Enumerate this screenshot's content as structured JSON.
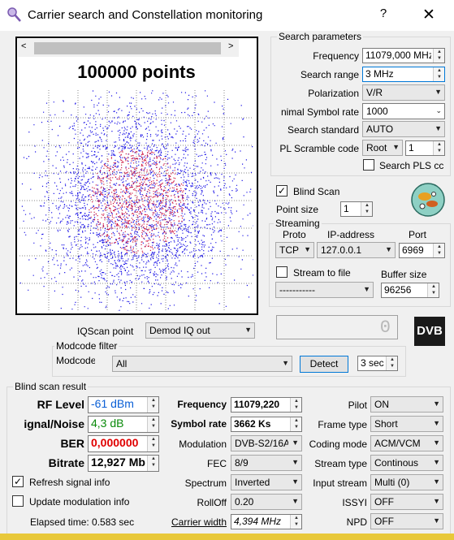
{
  "window": {
    "title": "Carrier search and Constellation monitoring",
    "help": "?",
    "close": "✕"
  },
  "scope": {
    "points_label": "100000 points"
  },
  "search_parameters": {
    "group_title": "Search parameters",
    "frequency_label": "Frequency",
    "frequency_value": "11079,000 MHz",
    "search_range_label": "Search range",
    "search_range_value": "3 MHz",
    "polarization_label": "Polarization",
    "polarization_value": "V/R",
    "min_symbol_rate_label": "nimal Symbol rate",
    "min_symbol_rate_value": "1000",
    "search_standard_label": "Search standard",
    "search_standard_value": "AUTO",
    "pl_scramble_label": "PL Scramble code",
    "pl_scramble_mode": "Root",
    "pl_scramble_value": "1",
    "search_pls_label": "Search PLS cc"
  },
  "blind_scan": {
    "label": "Blind Scan",
    "checked": "✓"
  },
  "point_size": {
    "label": "Point size",
    "value": "1"
  },
  "streaming": {
    "group_title": "Streaming",
    "proto_label": "Proto",
    "proto_value": "TCP",
    "ip_label": "IP-address",
    "ip_value": "127.0.0.1",
    "port_label": "Port",
    "port_value": "6969",
    "stream_to_file_label": "Stream to file",
    "file_value": "-----------",
    "buffer_size_label": "Buffer size",
    "buffer_size_value": "96256"
  },
  "iq": {
    "label": "IQScan point",
    "value": "Demod IQ out",
    "counter": "0"
  },
  "modcode": {
    "group_title": "Modcode filter",
    "label": "Modcode",
    "value": "All",
    "detect": "Detect",
    "time_value": "3 sec"
  },
  "dvb_logo": "DVB",
  "result": {
    "group_title": "Blind scan result",
    "rf_level_label": "RF Level",
    "rf_level_value": "-61 dBm",
    "snr_label": "ignal/Noise",
    "snr_value": "4,3 dB",
    "ber_label": "BER",
    "ber_value": "0,000000",
    "bitrate_label": "Bitrate",
    "bitrate_value": "12,927 Mb",
    "frequency_label": "Frequency",
    "frequency_value": "11079,220",
    "symbol_rate_label": "Symbol rate",
    "symbol_rate_value": "3662 Ks",
    "modulation_label": "Modulation",
    "modulation_value": "DVB-S2/16A",
    "fec_label": "FEC",
    "fec_value": "8/9",
    "spectrum_label": "Spectrum",
    "spectrum_value": "Inverted",
    "rolloff_label": "RollOff",
    "rolloff_value": "0.20",
    "carrier_width_label": "Carrier width",
    "carrier_width_value": "4,394 MHz",
    "pilot_label": "Pilot",
    "pilot_value": "ON",
    "frame_type_label": "Frame type",
    "frame_type_value": "Short",
    "coding_mode_label": "Coding mode",
    "coding_mode_value": "ACM/VCM",
    "stream_type_label": "Stream type",
    "stream_type_value": "Continous",
    "input_stream_label": "Input stream",
    "input_stream_value": "Multi (0)",
    "issyi_label": "ISSYI",
    "issyi_value": "OFF",
    "npd_label": "NPD",
    "npd_value": "OFF"
  },
  "refresh_signal": {
    "label": "Refresh signal info",
    "checked": "✓"
  },
  "update_modulation": {
    "label": "Update modulation info"
  },
  "elapsed": {
    "label": "Elapsed time: 0.583 sec"
  },
  "colors": {
    "accent": "#0078d7",
    "rf_level": "#0a5fd6",
    "snr": "#0a8a0a",
    "ber": "#e00000",
    "dots_blue": "#1a12e6",
    "dots_red": "#d01840"
  }
}
